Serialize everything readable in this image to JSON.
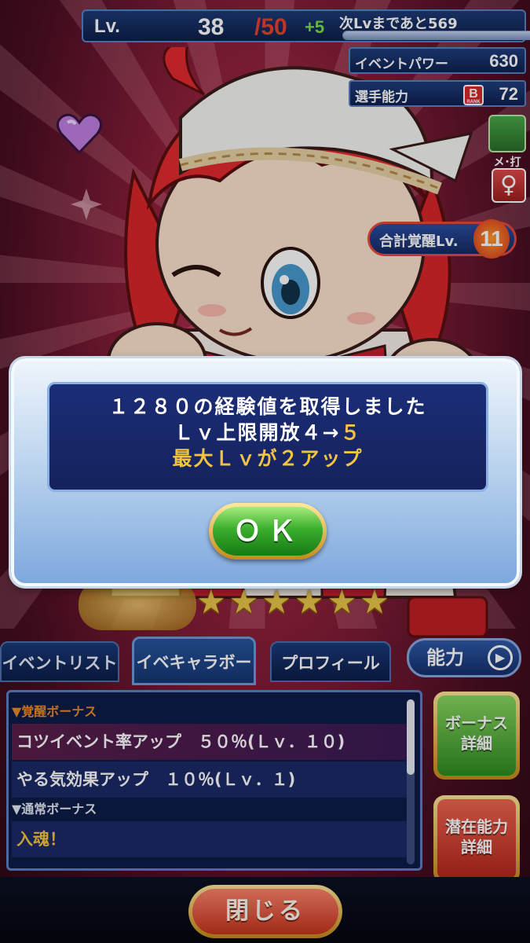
{
  "status": {
    "lv_label": "Lv.",
    "lv_current": "38",
    "lv_max": "/50",
    "lv_plus": "+5",
    "next_lv_text": "次Lvまであと569",
    "exp_progress": 0.9
  },
  "stats": {
    "event_power_label": "イベントパワー",
    "event_power_value": "630",
    "player_ability_label": "選手能力",
    "player_ability_rank": "B",
    "player_ability_rank_sub": "RANK",
    "player_ability_value": "72",
    "role_label": "メ･打",
    "gender_symbol": "♀",
    "awaken_label": "合計覚醒Lv.",
    "awaken_value": "11"
  },
  "character": {
    "stars": 6
  },
  "dialog": {
    "line1": "１２８０の経験値を取得しました",
    "line2_prefix": "Ｌｖ上限開放４→",
    "line2_highlight": "５",
    "line3": "最大Ｌｖが２アップ",
    "ok_label": "ＯＫ"
  },
  "tabs": {
    "event_list": "イベントリスト",
    "event_chara_bonus": "イベキャラボーナス",
    "profile": "プロフィール",
    "ability": "能力"
  },
  "bonus_panel": {
    "awaken_header": "▼覚醒ボーナス",
    "awaken_items": [
      "コツイベント率アップ　５０％(Ｌｖ．１０)",
      "やる気効果アップ　１０％(Ｌｖ．１)"
    ],
    "normal_header": "▼通常ボーナス",
    "normal_items": [
      "入魂！"
    ]
  },
  "side_buttons": {
    "bonus_detail_line1": "ボーナス",
    "bonus_detail_line2": "詳細",
    "potential_line1": "潜在能力",
    "potential_line2": "詳細"
  },
  "close_label": "閉じる",
  "colors": {
    "accent_gold": "#f2c341",
    "ok_green": "#3bae2d",
    "close_red": "#c52a1d",
    "dialog_navy": "#1b2d77"
  }
}
